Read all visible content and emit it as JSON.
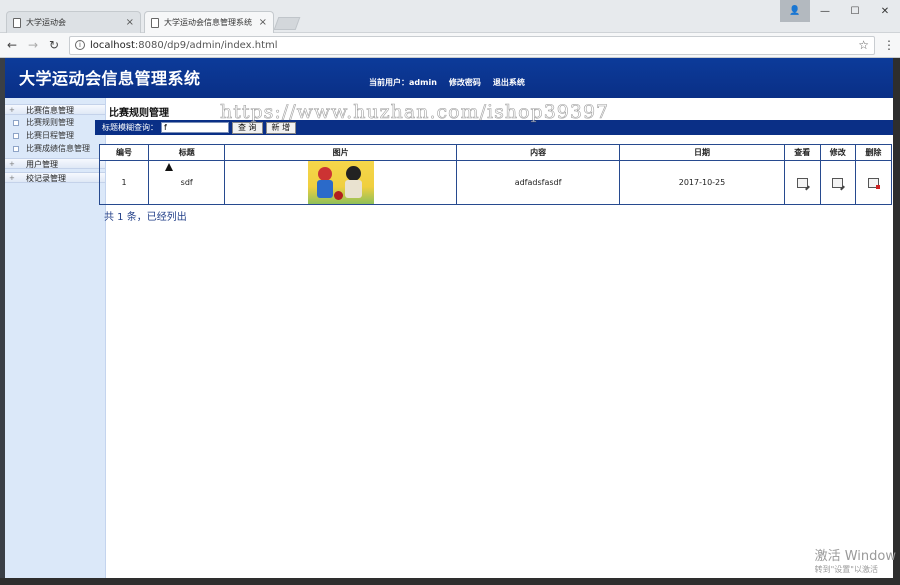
{
  "browser": {
    "tabs": [
      {
        "title": "大学运动会",
        "active": false
      },
      {
        "title": "大学运动会信息管理系统",
        "active": true
      }
    ],
    "url_host": "localhost",
    "url_path": ":8080/dp9/admin/index.html",
    "close_glyph": "×",
    "window_buttons": {
      "minimize": "—",
      "maximize": "☐",
      "close": "✕",
      "user": "👤"
    }
  },
  "app": {
    "title": "大学运动会信息管理系统",
    "user_label": "当前用户：admin",
    "change_password": "修改密码",
    "logout": "退出系统"
  },
  "sidebar": {
    "groups": [
      {
        "label": "比赛信息管理",
        "items": [
          "比赛规则管理",
          "比赛日程管理",
          "比赛成绩信息管理"
        ]
      },
      {
        "label": "用户管理",
        "items": []
      },
      {
        "label": "校记录管理",
        "items": []
      }
    ]
  },
  "main": {
    "section_title": "比赛规则管理",
    "search": {
      "label": "标题模糊查询：",
      "value": "f",
      "query_button": "查 询",
      "add_button": "新 增"
    },
    "table": {
      "headers": [
        "编号",
        "标题",
        "图片",
        "内容",
        "日期",
        "查看",
        "修改",
        "删除"
      ],
      "rows": [
        {
          "id": "1",
          "title": "sdf",
          "content": "adfadsfasdf",
          "date": "2017-10-25"
        }
      ]
    },
    "summary": "共 1 条，已经列出"
  },
  "overlay": {
    "watermark": "https://www.huzhan.com/ishop39397",
    "activate_title": "激活 Window",
    "activate_sub": "转到\"设置\"以激活"
  },
  "colors": {
    "header_bg": "#0c3b9a",
    "search_bar_bg": "#0a2f86",
    "sidebar_bg": "#dbe8f9",
    "table_border": "#274a8f"
  }
}
